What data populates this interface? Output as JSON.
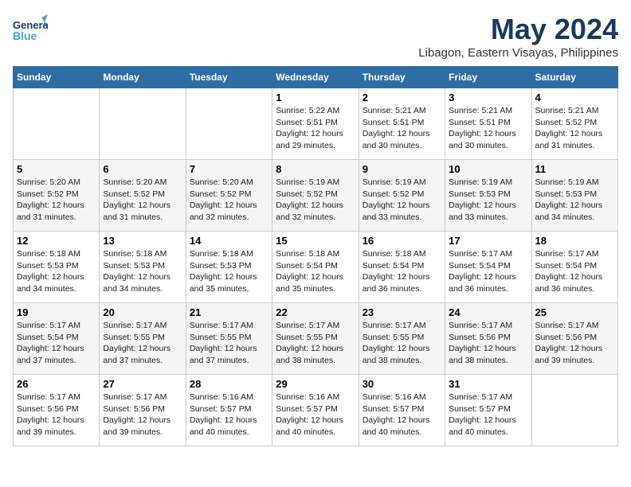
{
  "header": {
    "logo_general": "General",
    "logo_blue": "Blue",
    "month_title": "May 2024",
    "location": "Libagon, Eastern Visayas, Philippines"
  },
  "weekdays": [
    "Sunday",
    "Monday",
    "Tuesday",
    "Wednesday",
    "Thursday",
    "Friday",
    "Saturday"
  ],
  "weeks": [
    [
      {
        "day": "",
        "info": ""
      },
      {
        "day": "",
        "info": ""
      },
      {
        "day": "",
        "info": ""
      },
      {
        "day": "1",
        "info": "Sunrise: 5:22 AM\nSunset: 5:51 PM\nDaylight: 12 hours\nand 29 minutes."
      },
      {
        "day": "2",
        "info": "Sunrise: 5:21 AM\nSunset: 5:51 PM\nDaylight: 12 hours\nand 30 minutes."
      },
      {
        "day": "3",
        "info": "Sunrise: 5:21 AM\nSunset: 5:51 PM\nDaylight: 12 hours\nand 30 minutes."
      },
      {
        "day": "4",
        "info": "Sunrise: 5:21 AM\nSunset: 5:52 PM\nDaylight: 12 hours\nand 31 minutes."
      }
    ],
    [
      {
        "day": "5",
        "info": "Sunrise: 5:20 AM\nSunset: 5:52 PM\nDaylight: 12 hours\nand 31 minutes."
      },
      {
        "day": "6",
        "info": "Sunrise: 5:20 AM\nSunset: 5:52 PM\nDaylight: 12 hours\nand 31 minutes."
      },
      {
        "day": "7",
        "info": "Sunrise: 5:20 AM\nSunset: 5:52 PM\nDaylight: 12 hours\nand 32 minutes."
      },
      {
        "day": "8",
        "info": "Sunrise: 5:19 AM\nSunset: 5:52 PM\nDaylight: 12 hours\nand 32 minutes."
      },
      {
        "day": "9",
        "info": "Sunrise: 5:19 AM\nSunset: 5:52 PM\nDaylight: 12 hours\nand 33 minutes."
      },
      {
        "day": "10",
        "info": "Sunrise: 5:19 AM\nSunset: 5:53 PM\nDaylight: 12 hours\nand 33 minutes."
      },
      {
        "day": "11",
        "info": "Sunrise: 5:19 AM\nSunset: 5:53 PM\nDaylight: 12 hours\nand 34 minutes."
      }
    ],
    [
      {
        "day": "12",
        "info": "Sunrise: 5:18 AM\nSunset: 5:53 PM\nDaylight: 12 hours\nand 34 minutes."
      },
      {
        "day": "13",
        "info": "Sunrise: 5:18 AM\nSunset: 5:53 PM\nDaylight: 12 hours\nand 34 minutes."
      },
      {
        "day": "14",
        "info": "Sunrise: 5:18 AM\nSunset: 5:53 PM\nDaylight: 12 hours\nand 35 minutes."
      },
      {
        "day": "15",
        "info": "Sunrise: 5:18 AM\nSunset: 5:54 PM\nDaylight: 12 hours\nand 35 minutes."
      },
      {
        "day": "16",
        "info": "Sunrise: 5:18 AM\nSunset: 5:54 PM\nDaylight: 12 hours\nand 36 minutes."
      },
      {
        "day": "17",
        "info": "Sunrise: 5:17 AM\nSunset: 5:54 PM\nDaylight: 12 hours\nand 36 minutes."
      },
      {
        "day": "18",
        "info": "Sunrise: 5:17 AM\nSunset: 5:54 PM\nDaylight: 12 hours\nand 36 minutes."
      }
    ],
    [
      {
        "day": "19",
        "info": "Sunrise: 5:17 AM\nSunset: 5:54 PM\nDaylight: 12 hours\nand 37 minutes."
      },
      {
        "day": "20",
        "info": "Sunrise: 5:17 AM\nSunset: 5:55 PM\nDaylight: 12 hours\nand 37 minutes."
      },
      {
        "day": "21",
        "info": "Sunrise: 5:17 AM\nSunset: 5:55 PM\nDaylight: 12 hours\nand 37 minutes."
      },
      {
        "day": "22",
        "info": "Sunrise: 5:17 AM\nSunset: 5:55 PM\nDaylight: 12 hours\nand 38 minutes."
      },
      {
        "day": "23",
        "info": "Sunrise: 5:17 AM\nSunset: 5:55 PM\nDaylight: 12 hours\nand 38 minutes."
      },
      {
        "day": "24",
        "info": "Sunrise: 5:17 AM\nSunset: 5:56 PM\nDaylight: 12 hours\nand 38 minutes."
      },
      {
        "day": "25",
        "info": "Sunrise: 5:17 AM\nSunset: 5:56 PM\nDaylight: 12 hours\nand 39 minutes."
      }
    ],
    [
      {
        "day": "26",
        "info": "Sunrise: 5:17 AM\nSunset: 5:56 PM\nDaylight: 12 hours\nand 39 minutes."
      },
      {
        "day": "27",
        "info": "Sunrise: 5:17 AM\nSunset: 5:56 PM\nDaylight: 12 hours\nand 39 minutes."
      },
      {
        "day": "28",
        "info": "Sunrise: 5:16 AM\nSunset: 5:57 PM\nDaylight: 12 hours\nand 40 minutes."
      },
      {
        "day": "29",
        "info": "Sunrise: 5:16 AM\nSunset: 5:57 PM\nDaylight: 12 hours\nand 40 minutes."
      },
      {
        "day": "30",
        "info": "Sunrise: 5:16 AM\nSunset: 5:57 PM\nDaylight: 12 hours\nand 40 minutes."
      },
      {
        "day": "31",
        "info": "Sunrise: 5:17 AM\nSunset: 5:57 PM\nDaylight: 12 hours\nand 40 minutes."
      },
      {
        "day": "",
        "info": ""
      }
    ]
  ]
}
